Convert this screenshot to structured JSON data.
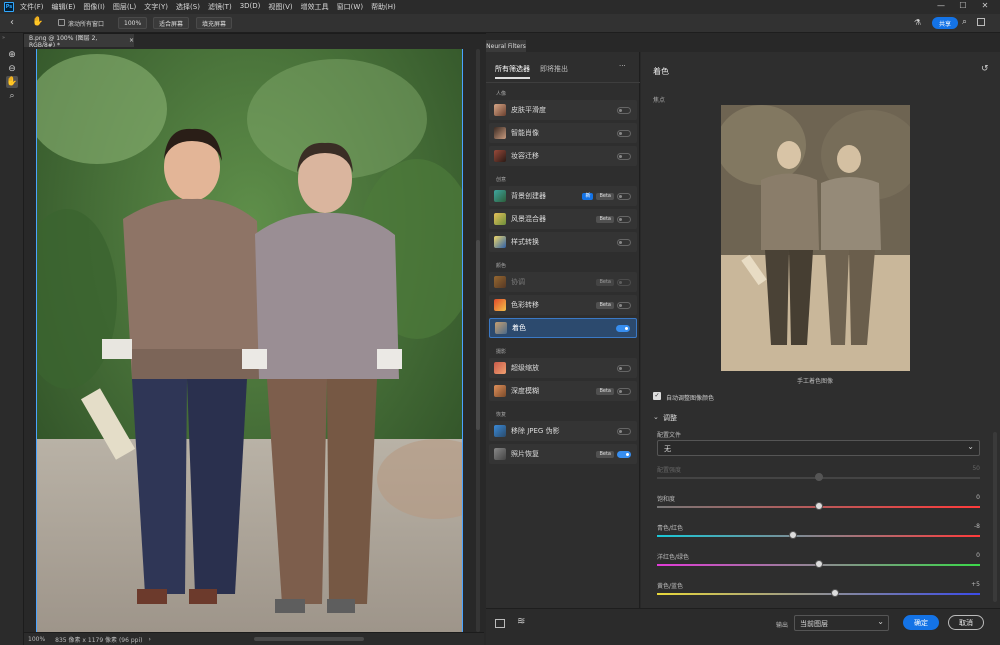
{
  "menubar": {
    "items": [
      "文件(F)",
      "编辑(E)",
      "图像(I)",
      "图层(L)",
      "文字(Y)",
      "选择(S)",
      "滤镜(T)",
      "3D(D)",
      "视图(V)",
      "增效工具",
      "窗口(W)",
      "帮助(H)"
    ]
  },
  "optionsbar": {
    "scroll_all_windows": "滚动所有窗口",
    "zoom_100": "100%",
    "fit_screen": "适合屏幕",
    "fill_screen": "填充屏幕",
    "share": "共享"
  },
  "document": {
    "tab_title": "B.png @ 100% (图层 2, RGB/8#) *",
    "close": "×",
    "status_zoom": "100%",
    "status_info": "835 像素 x 1179 像素 (96 ppi)"
  },
  "neural_filters": {
    "panel_tab": "Neural Filters",
    "tabs": [
      "所有筛选器",
      "即将推出"
    ],
    "more": "···",
    "sections": {
      "portrait": "人像",
      "creative": "创意",
      "color": "颜色",
      "photography": "摄影",
      "restoration": "恢复"
    },
    "filters": [
      {
        "label": "皮肤平滑度",
        "badge": "",
        "on": false
      },
      {
        "label": "智能肖像",
        "badge": "",
        "on": false
      },
      {
        "label": "妆容迁移",
        "badge": "",
        "on": false
      },
      {
        "label": "背景创建器",
        "badge": "新",
        "badge2": "Beta",
        "on": false
      },
      {
        "label": "风景混合器",
        "badge": "Beta",
        "on": false
      },
      {
        "label": "样式转换",
        "badge": "",
        "on": false
      },
      {
        "label": "协调",
        "badge": "Beta",
        "on": false
      },
      {
        "label": "色彩转移",
        "badge": "Beta",
        "on": false
      },
      {
        "label": "着色",
        "badge": "",
        "on": true
      },
      {
        "label": "超级缩放",
        "badge": "",
        "on": false
      },
      {
        "label": "深度模糊",
        "badge": "Beta",
        "on": false
      },
      {
        "label": "移除 JPEG 伪影",
        "badge": "",
        "on": false
      },
      {
        "label": "照片恢复",
        "badge": "Beta",
        "on": true
      }
    ]
  },
  "colorize": {
    "title": "着色",
    "focus_label": "焦点",
    "preview_caption": "手工着色图像",
    "auto_adjust_label": "自动调整图像颜色",
    "adjust_heading": "调整",
    "profile_label": "配置文件",
    "profile_value": "无",
    "sliders": [
      {
        "label": "配置强度",
        "value": "50",
        "pos": 0.5,
        "disabled": true,
        "track": "#444444"
      },
      {
        "label": "饱和度",
        "value": "0",
        "pos": 0.5,
        "track": "linear-gradient(90deg,#777,#ff3b3b)"
      },
      {
        "label": "青色/红色",
        "value": "-8",
        "pos": 0.42,
        "track": "linear-gradient(90deg,#19c9d8,#ff3b3b)"
      },
      {
        "label": "洋红色/绿色",
        "value": "0",
        "pos": 0.5,
        "track": "linear-gradient(90deg,#e23bd8,#3bd84a)"
      },
      {
        "label": "黄色/蓝色",
        "value": "+5",
        "pos": 0.55,
        "track": "linear-gradient(90deg,#e8d83b,#3b4be8)"
      }
    ]
  },
  "bottom": {
    "output_label": "输出",
    "output_value": "当前图层",
    "ok": "确定",
    "cancel": "取消"
  }
}
